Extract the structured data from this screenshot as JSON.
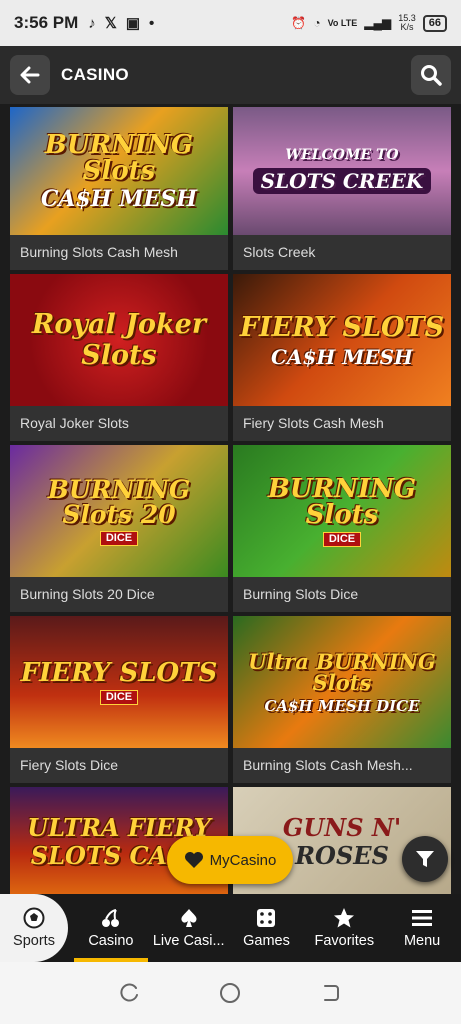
{
  "status": {
    "time": "3:56 PM",
    "net_speed_top": "15.3",
    "net_speed_bottom": "K/s",
    "volte": "Vo LTE",
    "battery": "66"
  },
  "header": {
    "title": "CASINO"
  },
  "games": [
    {
      "name": "Burning Slots Cash Mesh",
      "art_top": "BURNING Slots",
      "art_bottom": "CA$H MESH"
    },
    {
      "name": "Slots Creek",
      "art_top": "WELCOME TO",
      "art_bottom": "SLOTS CREEK"
    },
    {
      "name": "Royal Joker Slots",
      "art_top": "Royal Joker",
      "art_bottom": "Slots"
    },
    {
      "name": "Fiery Slots Cash Mesh",
      "art_top": "FIERY SLOTS",
      "art_bottom": "CA$H MESH"
    },
    {
      "name": "Burning Slots 20 Dice",
      "art_top": "BURNING Slots 20",
      "art_bottom": "DICE"
    },
    {
      "name": "Burning Slots Dice",
      "art_top": "BURNING Slots",
      "art_bottom": "DICE"
    },
    {
      "name": "Fiery Slots Dice",
      "art_top": "FIERY SLOTS",
      "art_bottom": "DICE"
    },
    {
      "name": "Burning Slots Cash Mesh...",
      "art_top": "Ultra BURNING Slots",
      "art_bottom": "CA$H MESH DICE"
    },
    {
      "name": "",
      "art_top": "ULTRA FIERY",
      "art_bottom": "SLOTS CASH"
    },
    {
      "name": "",
      "art_top": "GUNS N'",
      "art_bottom": "ROSES"
    }
  ],
  "floating": {
    "mycasino_label": "MyCasino"
  },
  "nav": {
    "sports": "Sports",
    "casino": "Casino",
    "live": "Live Casi...",
    "games": "Games",
    "favorites": "Favorites",
    "menu": "Menu"
  },
  "colors": {
    "accent": "#f6b800",
    "header_bg": "#2b2b2b",
    "card_bg": "#323232"
  }
}
